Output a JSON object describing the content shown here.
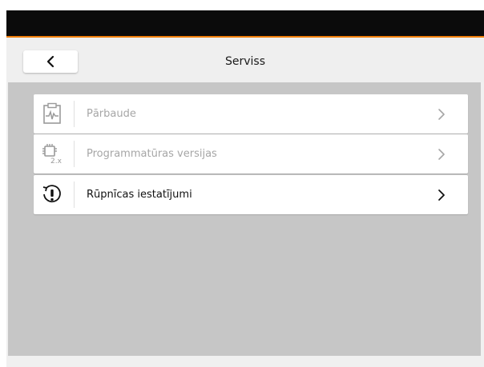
{
  "header": {
    "title": "Serviss",
    "back_icon": "chevron-left-icon"
  },
  "colors": {
    "top_bar": "#0b0b0b",
    "accent_line": "#ef7d00",
    "content_bg": "#c6c6c6",
    "disabled_text": "#a6a6a6"
  },
  "menu": {
    "items": [
      {
        "label": "Pārbaude",
        "icon": "diagnostics-test-icon",
        "enabled": false
      },
      {
        "label": "Programmatūras versijas",
        "icon": "chip-version-icon",
        "icon_text": "2.x",
        "enabled": false
      },
      {
        "label": "Rūpnīcas iestatījumi",
        "icon": "factory-reset-icon",
        "enabled": true
      }
    ]
  }
}
